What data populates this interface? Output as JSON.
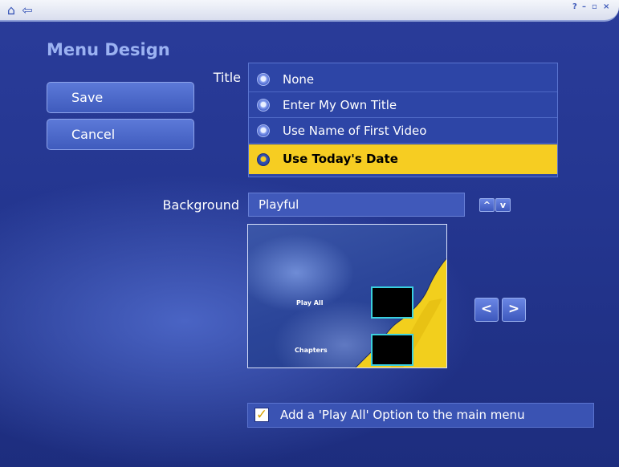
{
  "page_title": "Menu Design",
  "window_controls": [
    "?",
    "–",
    "▫",
    "×"
  ],
  "actions": {
    "save": "Save",
    "cancel": "Cancel"
  },
  "title_section": {
    "label": "Title",
    "options": [
      "None",
      "Enter My Own Title",
      "Use Name of First Video",
      "Use Today's Date"
    ],
    "selected_index": 3
  },
  "background": {
    "label": "Background",
    "value": "Playful",
    "up_icon": "^",
    "down_icon": "v"
  },
  "preview": {
    "play_all": "Play All",
    "chapters": "Chapters",
    "prev_icon": "<",
    "next_icon": ">"
  },
  "checkbox": {
    "checked": true,
    "label": "Add a 'Play All' Option to the main menu"
  },
  "colors": {
    "accent": "#f6cd22",
    "panel": "#2d45a6",
    "bg": "#243690"
  }
}
